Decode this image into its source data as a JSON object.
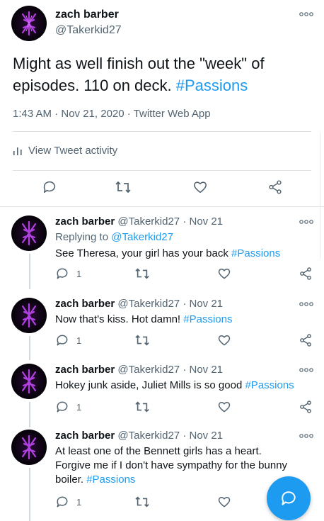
{
  "main_tweet": {
    "name": "zach barber",
    "handle": "@Takerkid27",
    "text_main": "Might as well finish out the \"week\" of episodes. 110 on deck. ",
    "hashtag": "#Passions",
    "meta": "1:43 AM · Nov 21, 2020 · Twitter Web App",
    "activity_label": "View Tweet activity"
  },
  "replies": [
    {
      "name": "zach barber",
      "handle": "@Takerkid27",
      "date": "· Nov 21",
      "replying_prefix": "Replying to ",
      "replying_to": "@Takerkid27",
      "text": "See Theresa, your girl has your back ",
      "hashtag": "#Passions",
      "reply_count": "1"
    },
    {
      "name": "zach barber",
      "handle": "@Takerkid27",
      "date": "· Nov 21",
      "text": "Now that's kiss. Hot damn! ",
      "hashtag": "#Passions",
      "reply_count": "1"
    },
    {
      "name": "zach barber",
      "handle": "@Takerkid27",
      "date": "· Nov 21",
      "text": "Hokey junk aside, Juliet Mills is so good ",
      "hashtag": "#Passions",
      "reply_count": "1"
    },
    {
      "name": "zach barber",
      "handle": "@Takerkid27",
      "date": "· Nov 21",
      "text": "At least one of the Bennett girls has a heart. Forgive me if I don't have sympathy for the bunny boiler. ",
      "hashtag": "#Passions",
      "reply_count": "1"
    }
  ],
  "icons": {
    "reply": "reply-icon",
    "retweet": "retweet-icon",
    "like": "like-icon",
    "share": "share-icon",
    "more": "more-icon",
    "compose": "compose-reply-icon",
    "activity": "activity-icon"
  },
  "colors": {
    "accent": "#1d9bf0",
    "secondary_text": "#536471",
    "primary_text": "#0f1419"
  }
}
